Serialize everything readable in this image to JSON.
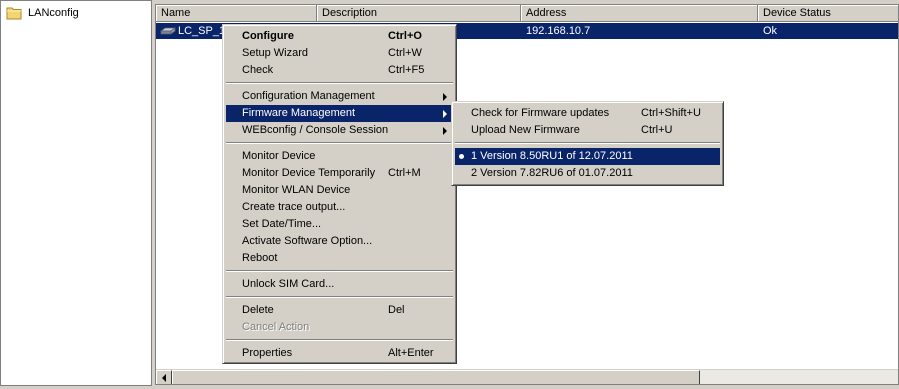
{
  "tree": {
    "root_label": "LANconfig",
    "root_icon": "folder-icon"
  },
  "list": {
    "columns": [
      "Name",
      "Description",
      "Address",
      "Device Status"
    ],
    "rows": [
      {
        "name": "LC_SP_1",
        "description": "",
        "address": "192.168.10.7",
        "status": "Ok",
        "icon": "router-device-icon"
      }
    ]
  },
  "context_menu": {
    "items": [
      {
        "label": "Configure",
        "shortcut": "Ctrl+O",
        "bold": true
      },
      {
        "label": "Setup Wizard",
        "shortcut": "Ctrl+W"
      },
      {
        "label": "Check",
        "shortcut": "Ctrl+F5"
      },
      {
        "label": "Configuration Management",
        "submenu": true
      },
      {
        "label": "Firmware Management",
        "submenu": true,
        "selected": true
      },
      {
        "label": "WEBconfig / Console Session",
        "submenu": true
      },
      {
        "label": "Monitor Device"
      },
      {
        "label": "Monitor Device Temporarily",
        "shortcut": "Ctrl+M"
      },
      {
        "label": "Monitor WLAN Device"
      },
      {
        "label": "Create trace output..."
      },
      {
        "label": "Set Date/Time..."
      },
      {
        "label": "Activate Software Option..."
      },
      {
        "label": "Reboot"
      },
      {
        "label": "Unlock SIM Card..."
      },
      {
        "label": "Delete",
        "shortcut": "Del"
      },
      {
        "label": "Cancel Action",
        "disabled": true
      },
      {
        "label": "Properties",
        "shortcut": "Alt+Enter"
      }
    ]
  },
  "firmware_submenu": {
    "items": [
      {
        "label": "Check for Firmware updates",
        "shortcut": "Ctrl+Shift+U"
      },
      {
        "label": "Upload New Firmware",
        "shortcut": "Ctrl+U"
      },
      {
        "label": "1 Version 8.50RU1 of 12.07.2011",
        "selected": true,
        "radio": true
      },
      {
        "label": "2 Version 7.82RU6 of 01.07.2011"
      }
    ]
  },
  "colors": {
    "selection": "#0a246a",
    "face": "#d4d0c8"
  }
}
